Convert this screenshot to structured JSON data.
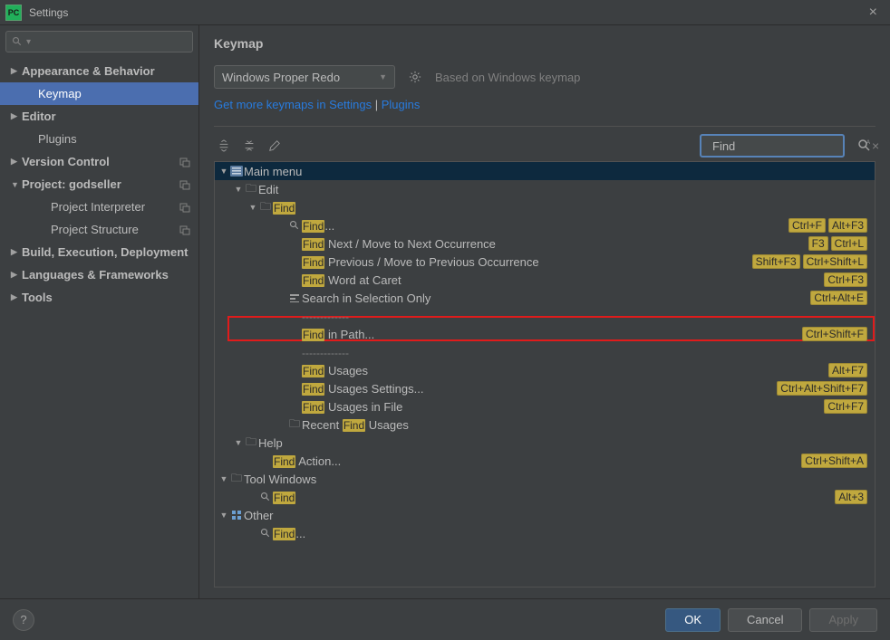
{
  "window": {
    "title": "Settings"
  },
  "sidebar": {
    "search_placeholder": "",
    "items": [
      {
        "label": "Appearance & Behavior",
        "caret": "▶",
        "bold": true
      },
      {
        "label": "Keymap",
        "indent": 1,
        "selected": true
      },
      {
        "label": "Editor",
        "caret": "▶",
        "bold": true
      },
      {
        "label": "Plugins",
        "indent": 1
      },
      {
        "label": "Version Control",
        "caret": "▶",
        "bold": true,
        "badge": true
      },
      {
        "label": "Project: godseller",
        "caret": "▼",
        "bold": true,
        "badge": true
      },
      {
        "label": "Project Interpreter",
        "indent": 2,
        "badge": true
      },
      {
        "label": "Project Structure",
        "indent": 2,
        "badge": true
      },
      {
        "label": "Build, Execution, Deployment",
        "caret": "▶",
        "bold": true
      },
      {
        "label": "Languages & Frameworks",
        "caret": "▶",
        "bold": true
      },
      {
        "label": "Tools",
        "caret": "▶",
        "bold": true
      }
    ]
  },
  "content": {
    "title": "Keymap",
    "scheme": "Windows Proper Redo",
    "based_on": "Based on Windows keymap",
    "links_a": "Get more keymaps in Settings",
    "links_sep": " | ",
    "links_b": "Plugins",
    "search_value": "Find"
  },
  "tree": {
    "main_menu": "Main menu",
    "edit": "Edit",
    "find_group": "Find",
    "items": {
      "find": {
        "hl": "Find",
        "rest": "...",
        "sc": [
          "Ctrl+F",
          "Alt+F3"
        ]
      },
      "next": {
        "hl": "Find",
        "rest": " Next / Move to Next Occurrence",
        "sc": [
          "F3",
          "Ctrl+L"
        ]
      },
      "prev": {
        "hl": "Find",
        "rest": " Previous / Move to Previous Occurrence",
        "sc": [
          "Shift+F3",
          "Ctrl+Shift+L"
        ]
      },
      "word": {
        "hl": "Find",
        "rest": " Word at Caret",
        "sc": [
          "Ctrl+F3"
        ]
      },
      "selonly": {
        "rest": "Search in Selection Only",
        "sc": [
          "Ctrl+Alt+E"
        ]
      },
      "sep": "-------------",
      "inpath": {
        "hl": "Find",
        "rest": " in Path...",
        "sc": [
          "Ctrl+Shift+F"
        ]
      },
      "usages": {
        "hl": "Find",
        "rest": " Usages",
        "sc": [
          "Alt+F7"
        ]
      },
      "usages_settings": {
        "hl": "Find",
        "rest": " Usages Settings...",
        "sc": [
          "Ctrl+Alt+Shift+F7"
        ]
      },
      "usages_file": {
        "hl": "Find",
        "rest": " Usages in File",
        "sc": [
          "Ctrl+F7"
        ]
      },
      "recent": {
        "pre": "Recent ",
        "hl": "Find",
        "rest": " Usages"
      },
      "help": "Help",
      "action": {
        "hl": "Find",
        "rest": " Action...",
        "sc": [
          "Ctrl+Shift+A"
        ]
      },
      "tool_windows": "Tool Windows",
      "find_tw": {
        "hl": "Find",
        "sc": [
          "Alt+3"
        ]
      },
      "other": "Other",
      "find_other": {
        "hl": "Find",
        "rest": "..."
      }
    }
  },
  "footer": {
    "ok": "OK",
    "cancel": "Cancel",
    "apply": "Apply"
  }
}
